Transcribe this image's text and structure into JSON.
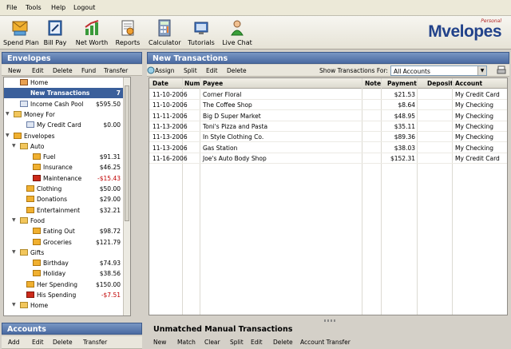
{
  "menu": [
    "File",
    "Tools",
    "Help",
    "Logout"
  ],
  "toolbar": {
    "buttons": [
      "Spend Plan",
      "Bill Pay",
      "Net Worth",
      "Reports",
      "Calculator",
      "Tutorials",
      "Live Chat"
    ],
    "icons": [
      "spend-plan-icon",
      "bill-pay-icon",
      "net-worth-icon",
      "reports-icon",
      "calculator-icon",
      "tutorials-icon",
      "live-chat-icon"
    ],
    "logo": "Mvelopes",
    "logo_sup": "Personal"
  },
  "envelopes": {
    "title": "Envelopes",
    "actions": [
      "New",
      "Edit",
      "Delete",
      "Fund",
      "Transfer"
    ],
    "items": [
      {
        "name": "Home",
        "amount": "",
        "icon": "house",
        "twisty": "",
        "level": 1,
        "selected": false
      },
      {
        "name": "New Transactions",
        "amount": "7",
        "icon": "none",
        "twisty": "",
        "level": 1,
        "selected": true
      },
      {
        "name": "Income Cash Pool",
        "amount": "$595.50",
        "icon": "card",
        "twisty": "",
        "level": 1,
        "selected": false
      },
      {
        "name": "Money For",
        "amount": "",
        "icon": "folder",
        "twisty": "open",
        "level": 0,
        "selected": false
      },
      {
        "name": "My Credit Card",
        "amount": "$0.00",
        "icon": "card",
        "twisty": "",
        "level": 2,
        "selected": false
      },
      {
        "name": "Envelopes",
        "amount": "",
        "icon": "envelope",
        "twisty": "open",
        "level": 0,
        "selected": false
      },
      {
        "name": "Auto",
        "amount": "",
        "icon": "folder",
        "twisty": "open",
        "level": 1,
        "selected": false
      },
      {
        "name": "Fuel",
        "amount": "$91.31",
        "icon": "envelope",
        "twisty": "",
        "level": 3,
        "selected": false
      },
      {
        "name": "Insurance",
        "amount": "$46.25",
        "icon": "envelope",
        "twisty": "",
        "level": 3,
        "selected": false
      },
      {
        "name": "Maintenance",
        "amount": "-$15.43",
        "icon": "envelope-red",
        "twisty": "",
        "level": 3,
        "selected": false,
        "negative": true
      },
      {
        "name": "Clothing",
        "amount": "$50.00",
        "icon": "envelope",
        "twisty": "",
        "level": 2,
        "selected": false
      },
      {
        "name": "Donations",
        "amount": "$29.00",
        "icon": "envelope",
        "twisty": "",
        "level": 2,
        "selected": false
      },
      {
        "name": "Entertainment",
        "amount": "$32.21",
        "icon": "envelope",
        "twisty": "",
        "level": 2,
        "selected": false
      },
      {
        "name": "Food",
        "amount": "",
        "icon": "folder",
        "twisty": "open",
        "level": 1,
        "selected": false
      },
      {
        "name": "Eating Out",
        "amount": "$98.72",
        "icon": "envelope",
        "twisty": "",
        "level": 3,
        "selected": false
      },
      {
        "name": "Groceries",
        "amount": "$121.79",
        "icon": "envelope",
        "twisty": "",
        "level": 3,
        "selected": false
      },
      {
        "name": "Gifts",
        "amount": "",
        "icon": "folder",
        "twisty": "open",
        "level": 1,
        "selected": false
      },
      {
        "name": "Birthday",
        "amount": "$74.93",
        "icon": "envelope",
        "twisty": "",
        "level": 3,
        "selected": false
      },
      {
        "name": "Holiday",
        "amount": "$38.56",
        "icon": "envelope",
        "twisty": "",
        "level": 3,
        "selected": false
      },
      {
        "name": "Her Spending",
        "amount": "$150.00",
        "icon": "envelope",
        "twisty": "",
        "level": 2,
        "selected": false
      },
      {
        "name": "His Spending",
        "amount": "-$7.51",
        "icon": "envelope-red",
        "twisty": "",
        "level": 2,
        "selected": false,
        "negative": true
      },
      {
        "name": "Home",
        "amount": "",
        "icon": "folder",
        "twisty": "open",
        "level": 1,
        "selected": false
      }
    ]
  },
  "accounts": {
    "title": "Accounts",
    "actions": [
      "Add",
      "Edit",
      "Delete",
      "Transfer"
    ]
  },
  "transactions": {
    "title": "New Transactions",
    "actions": [
      "Assign",
      "Split",
      "Edit",
      "Delete"
    ],
    "filter_label": "Show Transactions For:",
    "filter_value": "All Accounts",
    "columns": [
      "Date",
      "Num",
      "Payee",
      "Note",
      "Payment",
      "Deposit",
      "Account"
    ],
    "rows": [
      [
        "11-10-2006",
        "",
        "Corner Floral",
        "",
        "$21.53",
        "",
        "My Credit Card"
      ],
      [
        "11-10-2006",
        "",
        "The Coffee Shop",
        "",
        "$8.64",
        "",
        "My Checking"
      ],
      [
        "11-11-2006",
        "",
        "Big D Super Market",
        "",
        "$48.95",
        "",
        "My Checking"
      ],
      [
        "11-13-2006",
        "",
        "Toni's Pizza and Pasta",
        "",
        "$35.11",
        "",
        "My Checking"
      ],
      [
        "11-13-2006",
        "",
        "In Style Clothing Co.",
        "",
        "$89.36",
        "",
        "My Checking"
      ],
      [
        "11-13-2006",
        "",
        "Gas Station",
        "",
        "$38.03",
        "",
        "My Checking"
      ],
      [
        "11-16-2006",
        "",
        "Joe's Auto Body Shop",
        "",
        "$152.31",
        "",
        "My Credit Card"
      ]
    ]
  },
  "unmatched": {
    "title": "Unmatched Manual Transactions",
    "actions": [
      "New",
      "Match",
      "Clear",
      "Split",
      "Edit",
      "Delete",
      "Account Transfer"
    ]
  },
  "colors": {
    "panel_header": "#4a6aa1",
    "selected_row": "#3a5f9b",
    "negative": "#c00000",
    "logo": "#22428a"
  }
}
